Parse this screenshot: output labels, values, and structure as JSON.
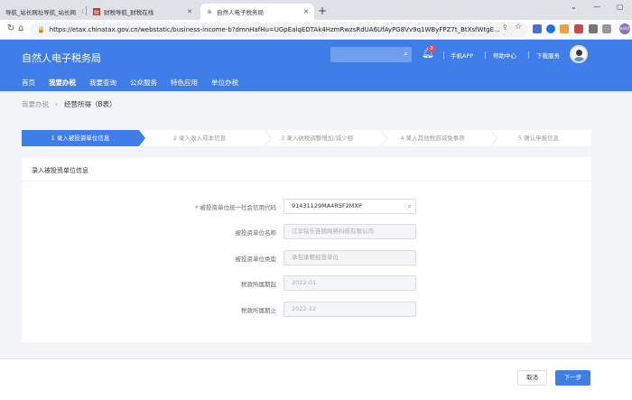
{
  "browser": {
    "tabs": [
      {
        "label": "导航_站长网址导航_站长网",
        "active": false
      },
      {
        "label": "财税导航_财税在线",
        "active": false
      },
      {
        "label": "自然人电子税务局",
        "active": true
      }
    ],
    "new_tab": "+",
    "url": "https://etax.chinatax.gov.cn/webstatic/business-income-b?dmnHafHu=UGpEalqEDTAk4HzmRwzsRdUA6UfAyPG8Vv9q1WByFPZ7t_BtXsfWtgE...",
    "profile": "未同步"
  },
  "site": {
    "title": "自然人电子税务局",
    "search_placeholder": "",
    "notification_count": "3",
    "links": [
      "手机APP",
      "帮助中心",
      "下载服务"
    ],
    "nav": [
      "首页",
      "我要办税",
      "我要查询",
      "公众服务",
      "特色应用",
      "单位办税"
    ],
    "nav_active_index": 1
  },
  "breadcrumb": {
    "parent": "我要办税",
    "sep": "›",
    "current": "经营所得（B表）"
  },
  "steps": [
    {
      "label": "1  录入被投资单位信息",
      "active": true
    },
    {
      "label": "2  录入收入成本信息",
      "active": false
    },
    {
      "label": "3  录入纳税调整增加/减少额",
      "active": false
    },
    {
      "label": "4  录入其他税前减免事项",
      "active": false
    },
    {
      "label": "5  确认申报信息",
      "active": false
    }
  ],
  "form": {
    "section_title": "录入被投资单位信息",
    "fields": [
      {
        "label": "被投资单位统一社会信用代码",
        "value": "91431129MA4R5F2MXP",
        "required": true,
        "editable": true
      },
      {
        "label": "被投资单位名称",
        "value": "江华钻乐连锁网络科技有限公司",
        "required": false,
        "editable": false
      },
      {
        "label": "被投资单位类型",
        "value": "承包承租经营单位",
        "required": false,
        "editable": false
      },
      {
        "label": "税款所属期起",
        "value": "2022-01",
        "required": false,
        "editable": false
      },
      {
        "label": "税款所属期止",
        "value": "2022-12",
        "required": false,
        "editable": false
      }
    ]
  },
  "footer": {
    "cancel_label": "取消",
    "next_label": "下一步"
  },
  "colors": {
    "primary": "#3f7ee8",
    "page_bg": "#f2f4f7"
  }
}
